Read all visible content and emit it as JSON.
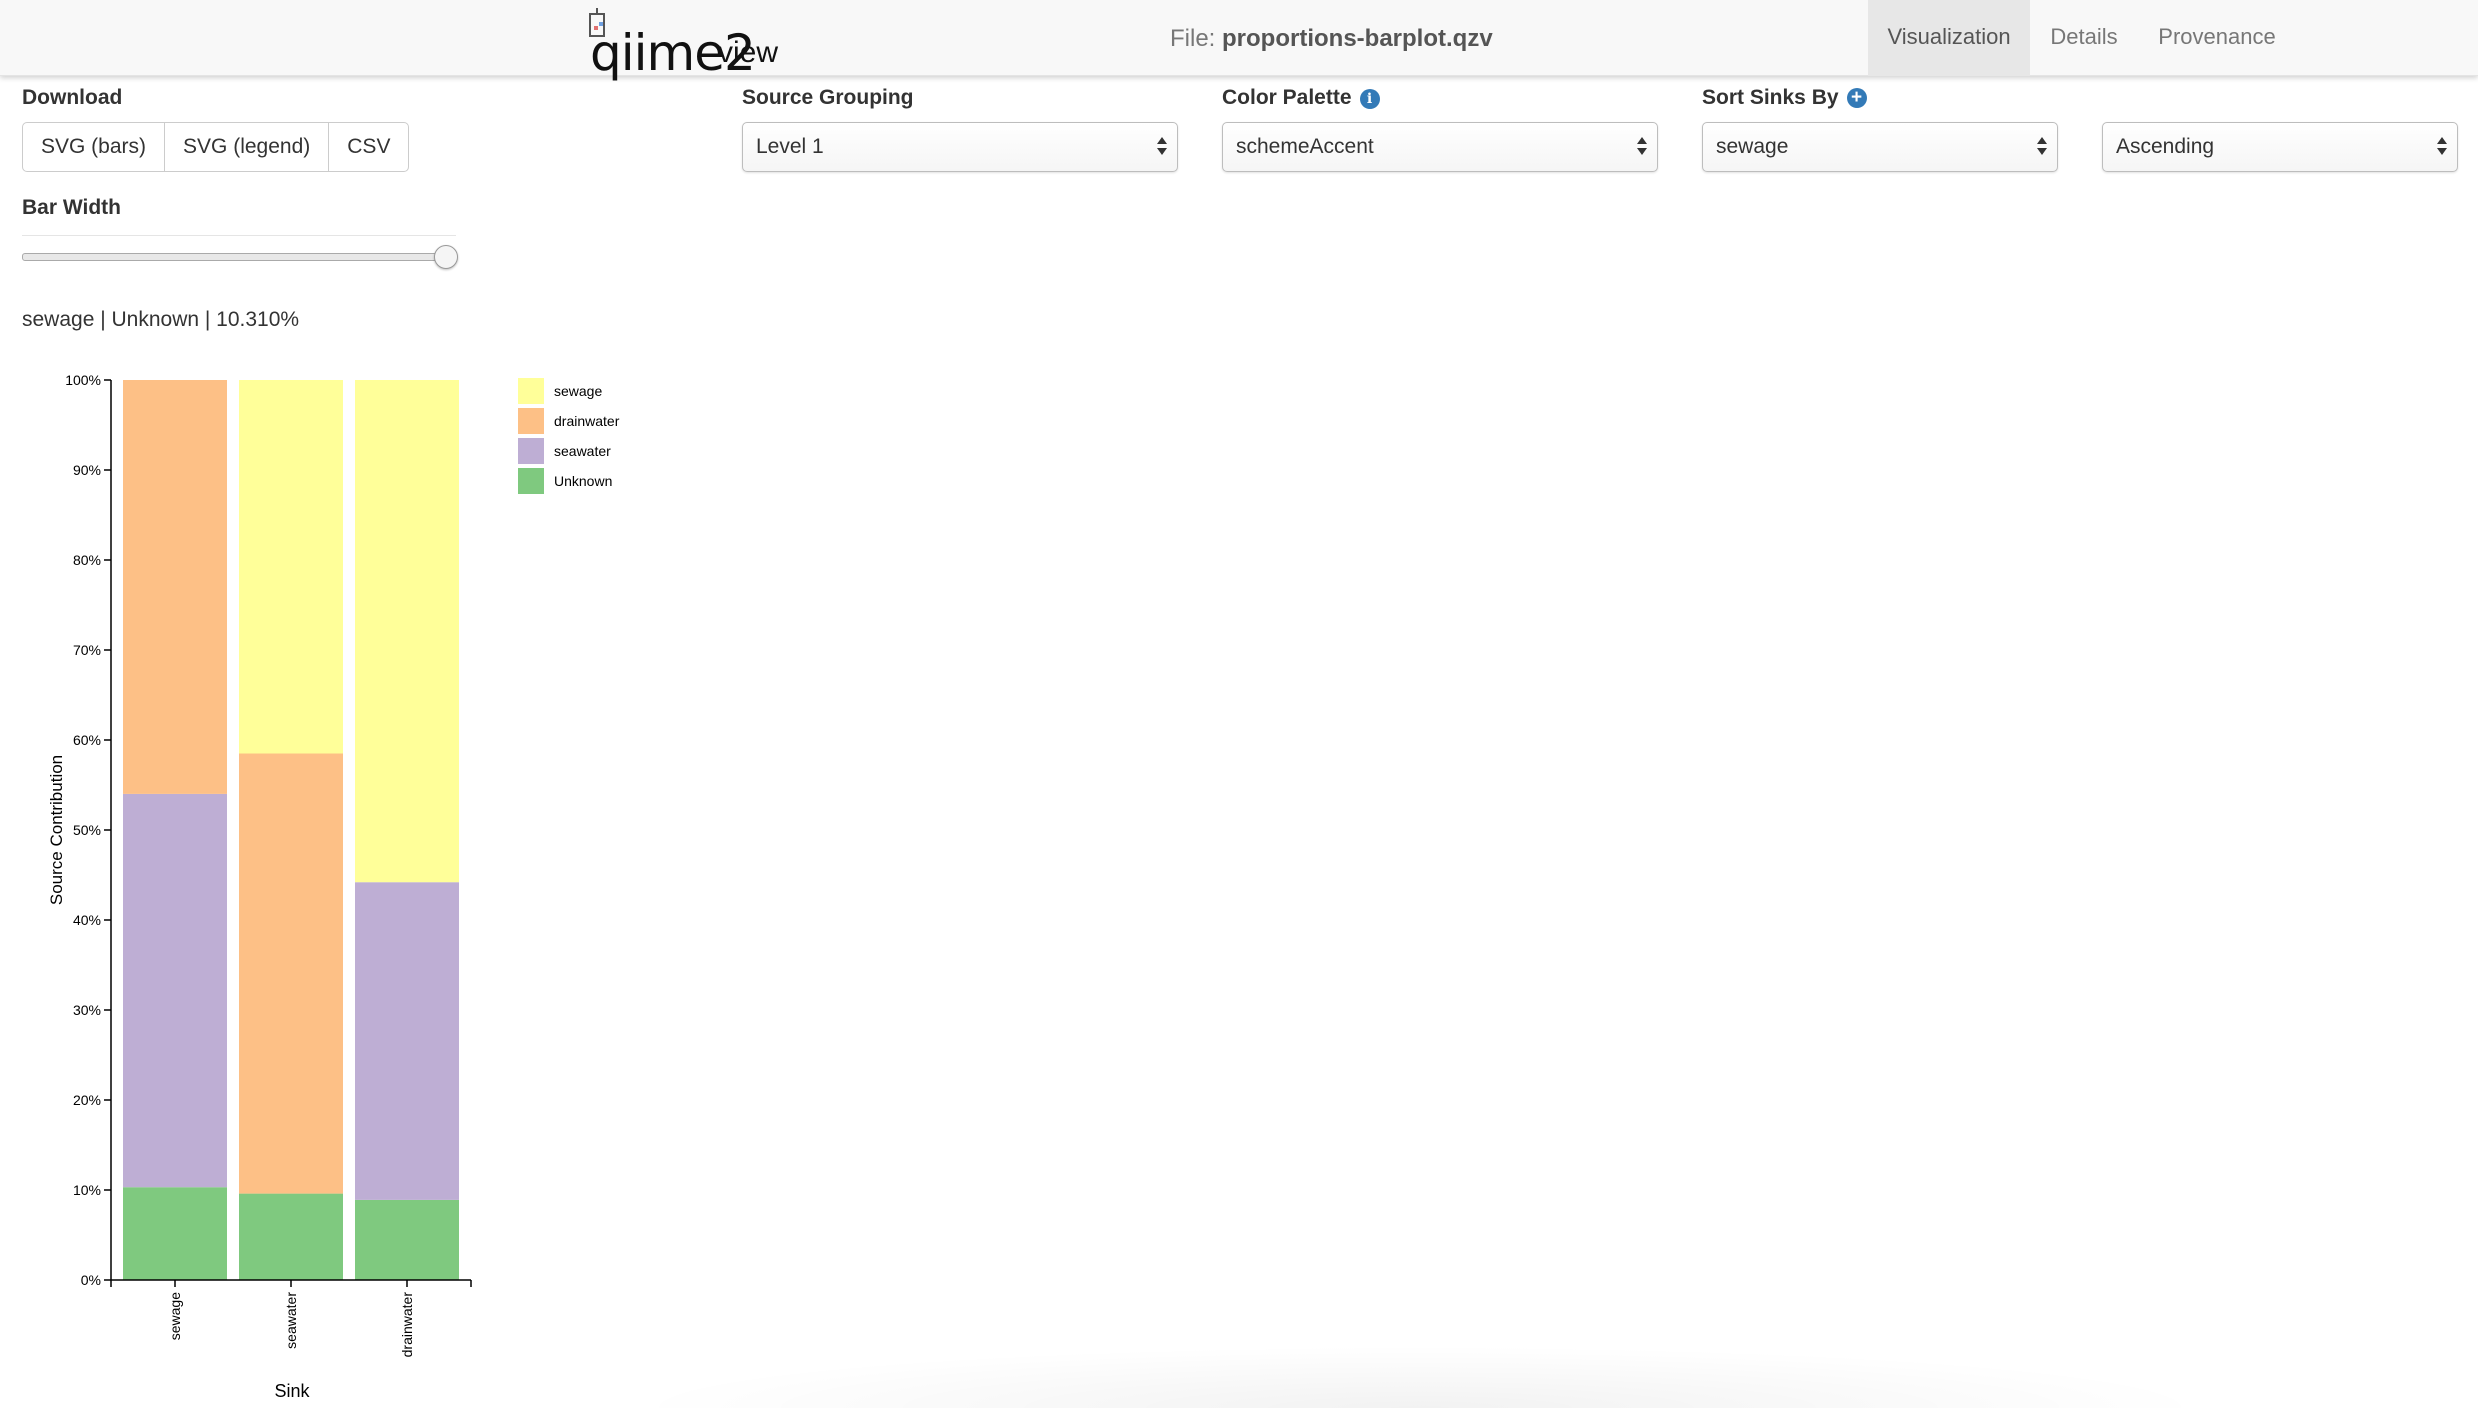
{
  "navbar": {
    "logo_text": "qiime2",
    "logo_sub": "view",
    "file_prefix": "File:",
    "file_name": "proportions-barplot.qzv",
    "tabs": [
      {
        "label": "Visualization",
        "active": true
      },
      {
        "label": "Details",
        "active": false
      },
      {
        "label": "Provenance",
        "active": false
      }
    ]
  },
  "controls": {
    "download_label": "Download",
    "download_buttons": [
      "SVG (bars)",
      "SVG (legend)",
      "CSV"
    ],
    "source_grouping_label": "Source Grouping",
    "source_grouping_value": "Level 1",
    "color_palette_label": "Color Palette",
    "color_palette_value": "schemeAccent",
    "sort_label": "Sort Sinks By",
    "sort_value": "sewage",
    "sort_order_value": "Ascending",
    "bar_width_label": "Bar Width",
    "bar_width_level": 1.0,
    "icons": {
      "color_palette": "info-icon",
      "sort": "plus-circle-icon"
    },
    "accent_color": "#337ab7"
  },
  "hover_info": "sewage | Unknown | 10.310%",
  "chart_data": {
    "type": "bar",
    "stacked": true,
    "categories": [
      "sewage",
      "seawater",
      "drainwater"
    ],
    "series": [
      {
        "name": "Unknown",
        "color": "#7fc97f",
        "values": [
          10.31,
          9.6,
          8.9
        ]
      },
      {
        "name": "seawater",
        "color": "#beaed4",
        "values": [
          43.7,
          0,
          35.3
        ]
      },
      {
        "name": "drainwater",
        "color": "#fdc086",
        "values": [
          45.99,
          48.9,
          0
        ]
      },
      {
        "name": "sewage",
        "color": "#ffff99",
        "values": [
          0,
          41.5,
          55.8
        ]
      }
    ],
    "legend": [
      "sewage",
      "drainwater",
      "seawater",
      "Unknown"
    ],
    "legend_placement": "top-right",
    "xlabel": "Sink",
    "ylabel": "Source Contribution",
    "ylim": [
      0,
      100
    ],
    "yticks": [
      "0%",
      "10%",
      "20%",
      "30%",
      "40%",
      "50%",
      "60%",
      "70%",
      "80%",
      "90%",
      "100%"
    ]
  }
}
